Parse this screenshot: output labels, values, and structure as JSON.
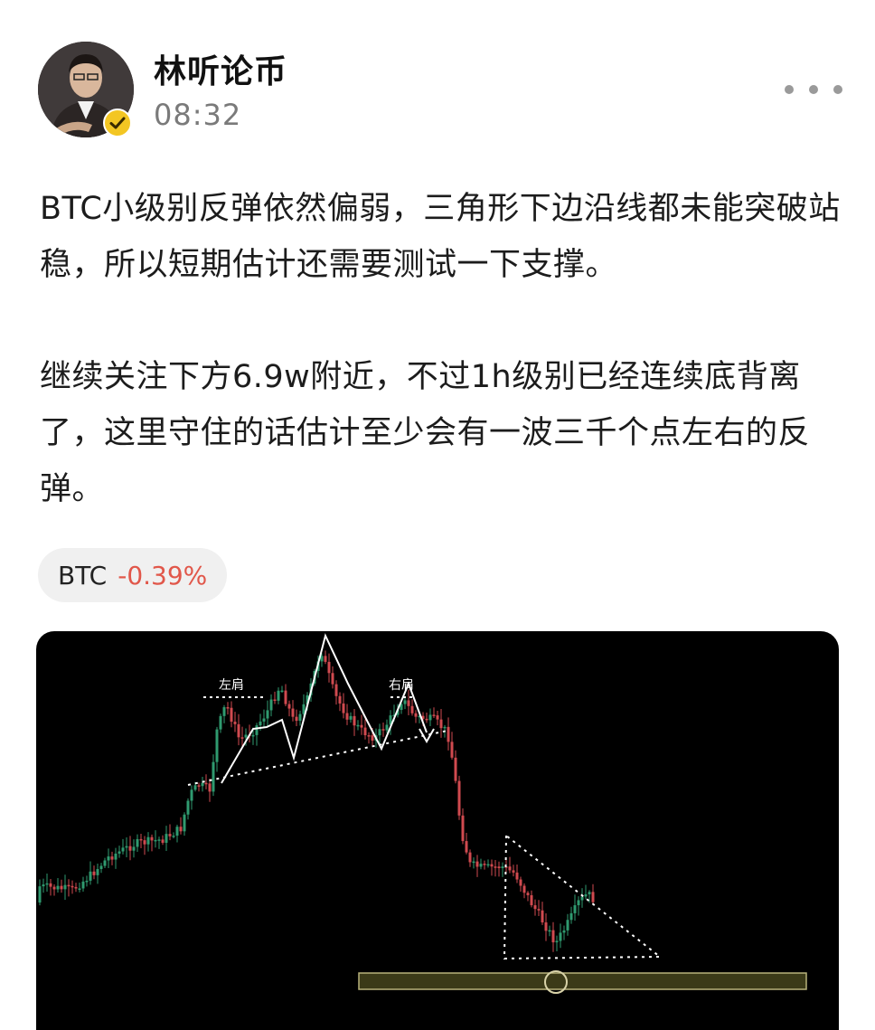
{
  "post": {
    "author": "林听论币",
    "time": "08:32",
    "paragraphs": [
      "BTC小级别反弹依然偏弱，三角形下边沿线都未能突破站稳，所以短期估计还需要测试一下支撑。",
      "继续关注下方6.9w附近，不过1h级别已经连续底背离了，这里守住的话估计至少会有一波三千个点左右的反弹。"
    ],
    "more_icon": "more-horizontal-icon",
    "verified_icon": "verified-badge-icon"
  },
  "ticker": {
    "symbol": "BTC",
    "change": "-0.39%",
    "change_color": "#e1574a"
  },
  "chart": {
    "annotations": {
      "left_shoulder": "左肩",
      "right_shoulder": "右肩"
    },
    "colors": {
      "up": "#2f9a6f",
      "down": "#d04a4f",
      "support_zone": "#3b3a18",
      "support_zone_border": "#b8b27a",
      "pattern_lines": "#ffffff"
    }
  },
  "chart_data": {
    "type": "candlestick",
    "title": "",
    "patterns": [
      "head-and-shoulders",
      "descending triangle",
      "support zone"
    ],
    "annotations": [
      "左肩",
      "右肩"
    ]
  }
}
